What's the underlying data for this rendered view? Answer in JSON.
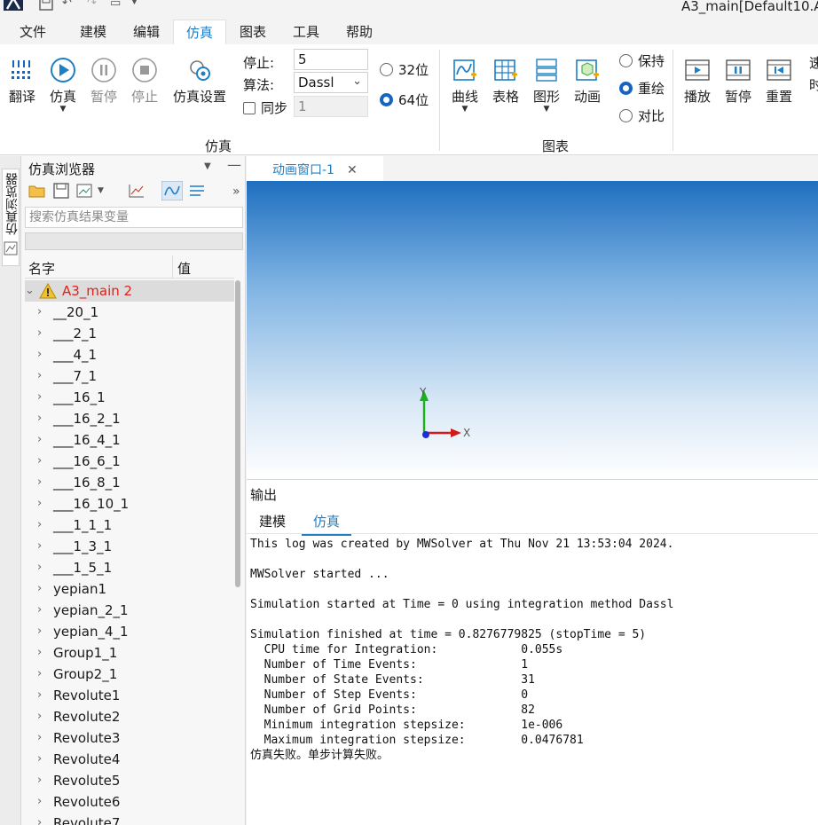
{
  "window": {
    "title": "A3_main[Default10.A"
  },
  "menu": {
    "tabs": [
      "文件",
      "建模",
      "编辑",
      "仿真",
      "图表",
      "工具",
      "帮助"
    ],
    "active": "仿真"
  },
  "ribbon": {
    "sim_group": {
      "translate": "翻译",
      "simulate": "仿真",
      "pause": "暂停",
      "stop": "停止",
      "settings": "仿真设置",
      "label": "仿真"
    },
    "params": {
      "stop_label": "停止:",
      "stop_value": "5",
      "algo_label": "算法:",
      "algo_value": "Dassl",
      "sync_label": "同步",
      "sync_value": "1",
      "bit32": "32位",
      "bit64": "64位",
      "selected_bits": "64位"
    },
    "chart_group": {
      "curve": "曲线",
      "table": "表格",
      "graphic": "图形",
      "animation": "动画",
      "label": "图表"
    },
    "display_mode": {
      "keep": "保持",
      "redraw": "重绘",
      "compare": "对比",
      "selected": "重绘"
    },
    "playback": {
      "play": "播放",
      "pause": "暂停",
      "reset": "重置",
      "speed": "速",
      "time": "时"
    }
  },
  "side_tab": {
    "label": "仿真浏览器"
  },
  "browser": {
    "title": "仿真浏览器",
    "search_placeholder": "搜索仿真结果变量",
    "col_name": "名字",
    "col_value": "值",
    "root": "A3_main 2",
    "items": [
      "__20_1",
      "___2_1",
      "___4_1",
      "___7_1",
      "___16_1",
      "___16_2_1",
      "___16_4_1",
      "___16_6_1",
      "___16_8_1",
      "___16_10_1",
      "___1_1_1",
      "___1_3_1",
      "___1_5_1",
      "yepian1",
      "yepian_2_1",
      "yepian_4_1",
      "Group1_1",
      "Group2_1",
      "Revolute1",
      "Revolute2",
      "Revolute3",
      "Revolute4",
      "Revolute5",
      "Revolute6",
      "Revolute7"
    ]
  },
  "document": {
    "tab": "动画窗口-1",
    "axis_x": "X",
    "axis_y": "Y"
  },
  "output": {
    "title": "输出",
    "tabs": [
      "建模",
      "仿真"
    ],
    "active_tab": "仿真",
    "log": [
      "This log was created by MWSolver at Thu Nov 21 13:53:04 2024.",
      "",
      "MWSolver started ...",
      "",
      "Simulation started at Time = 0 using integration method Dassl",
      "",
      "Simulation finished at time = 0.8276779825 (stopTime = 5)",
      "  CPU time for Integration:            0.055s",
      "  Number of Time Events:               1",
      "  Number of State Events:              31",
      "  Number of Step Events:               0",
      "  Number of Grid Points:               82",
      "  Minimum integration stepsize:        1e-006",
      "  Maximum integration stepsize:        0.0476781",
      "仿真失败。单步计算失败。"
    ]
  },
  "colors": {
    "accent": "#1e7fc4",
    "warning_text": "#e0201a",
    "radio_selected": "#1565c0"
  }
}
